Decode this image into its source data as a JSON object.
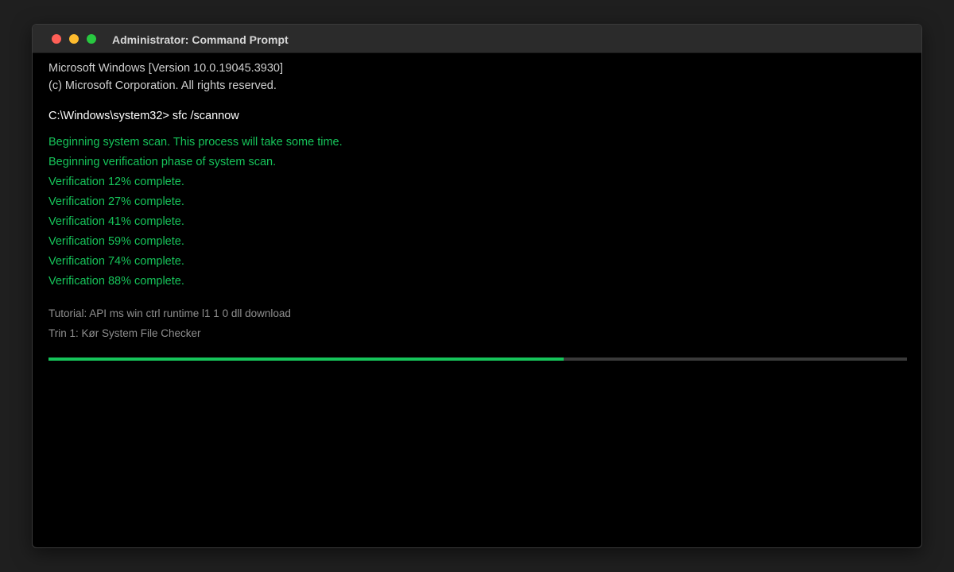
{
  "window": {
    "title": "Administrator: Command Prompt"
  },
  "console": {
    "header": [
      "Microsoft Windows [Version 10.0.19045.3930]",
      "(c) Microsoft Corporation. All rights reserved."
    ],
    "command": "C:\\Windows\\system32> sfc /scannow",
    "output": [
      "Beginning system scan. This process will take some time.",
      "Beginning verification phase of system scan.",
      "Verification 12% complete.",
      "Verification 27% complete.",
      "Verification 41% complete.",
      "Verification 59% complete.",
      "Verification 74% complete.",
      "Verification 88% complete."
    ],
    "tutorial": [
      "Tutorial: API ms win ctrl runtime l1 1 0 dll download",
      "Trin 1: Kør System File Checker"
    ]
  },
  "progress": {
    "fraction": 0.6
  },
  "colors": {
    "output_green": "#16c45a",
    "progress_track": "#3a3a3a",
    "close": "#ff5f57",
    "minimize": "#febc2e",
    "maximize": "#28c840"
  }
}
